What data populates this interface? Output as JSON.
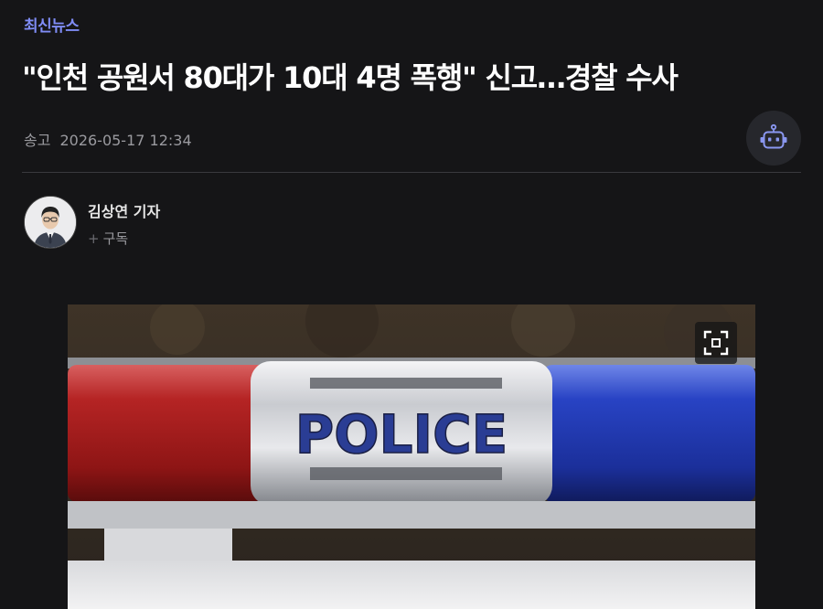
{
  "article": {
    "category": "최신뉴스",
    "headline": "\"인천 공원서 80대가 10대 4명 폭행\" 신고…경찰 수사",
    "sent_label": "송고",
    "sent_datetime": "2026-05-17 12:34"
  },
  "ai_button": {
    "icon": "robot-icon"
  },
  "reporter": {
    "name": "김상연 기자",
    "subscribe_label": "구독",
    "subscribe_icon": "plus-icon"
  },
  "photo": {
    "sign_text": "POLICE",
    "expand_icon": "expand-icon"
  },
  "colors": {
    "background": "#151517",
    "accent": "#7f8cf5",
    "police_blue": "#2a3d94",
    "light_red": "#b52424",
    "light_blue": "#2843c4"
  }
}
